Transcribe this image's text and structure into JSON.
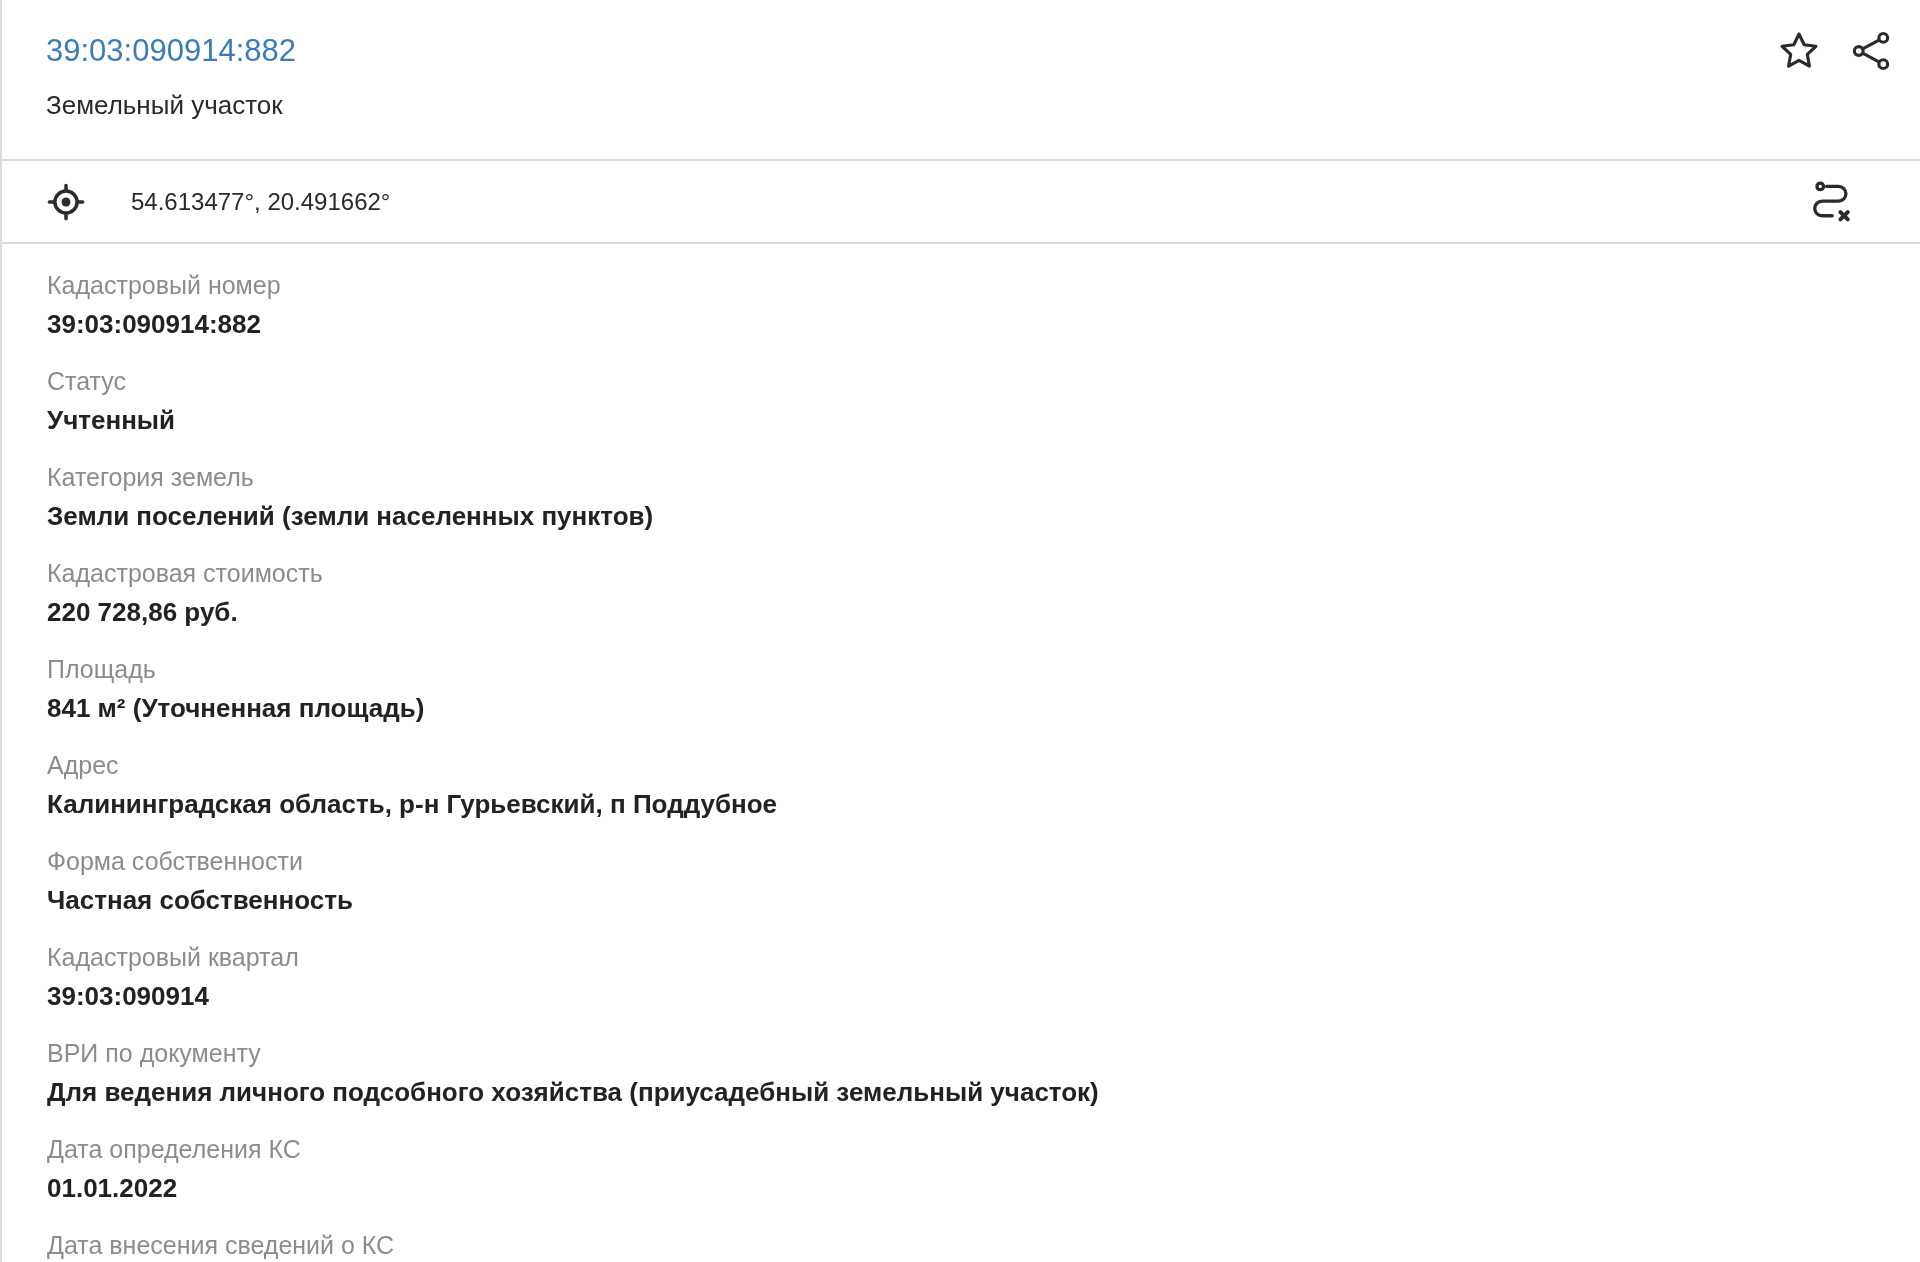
{
  "header": {
    "title": "39:03:090914:882",
    "subtitle": "Земельный участок",
    "favorited": false
  },
  "location": {
    "coordinates": "54.613477°, 20.491662°"
  },
  "fields": [
    {
      "label": "Кадастровый номер",
      "value": "39:03:090914:882"
    },
    {
      "label": "Статус",
      "value": "Учтенный"
    },
    {
      "label": "Категория земель",
      "value": "Земли поселений (земли населенных пунктов)"
    },
    {
      "label": "Кадастровая стоимость",
      "value": "220 728,86 руб."
    },
    {
      "label": "Площадь",
      "value": "841 м² (Уточненная площадь)"
    },
    {
      "label": "Адрес",
      "value": "Калининградская область, р-н Гурьевский, п Поддубное"
    },
    {
      "label": "Форма собственности",
      "value": "Частная собственность"
    },
    {
      "label": "Кадастровый квартал",
      "value": "39:03:090914"
    },
    {
      "label": "ВРИ по документу",
      "value": "Для ведения личного подсобного хозяйства (приусадебный земельный участок)"
    },
    {
      "label": "Дата определения КС",
      "value": "01.01.2022"
    },
    {
      "label": "Дата внесения сведений о КС"
    }
  ]
}
